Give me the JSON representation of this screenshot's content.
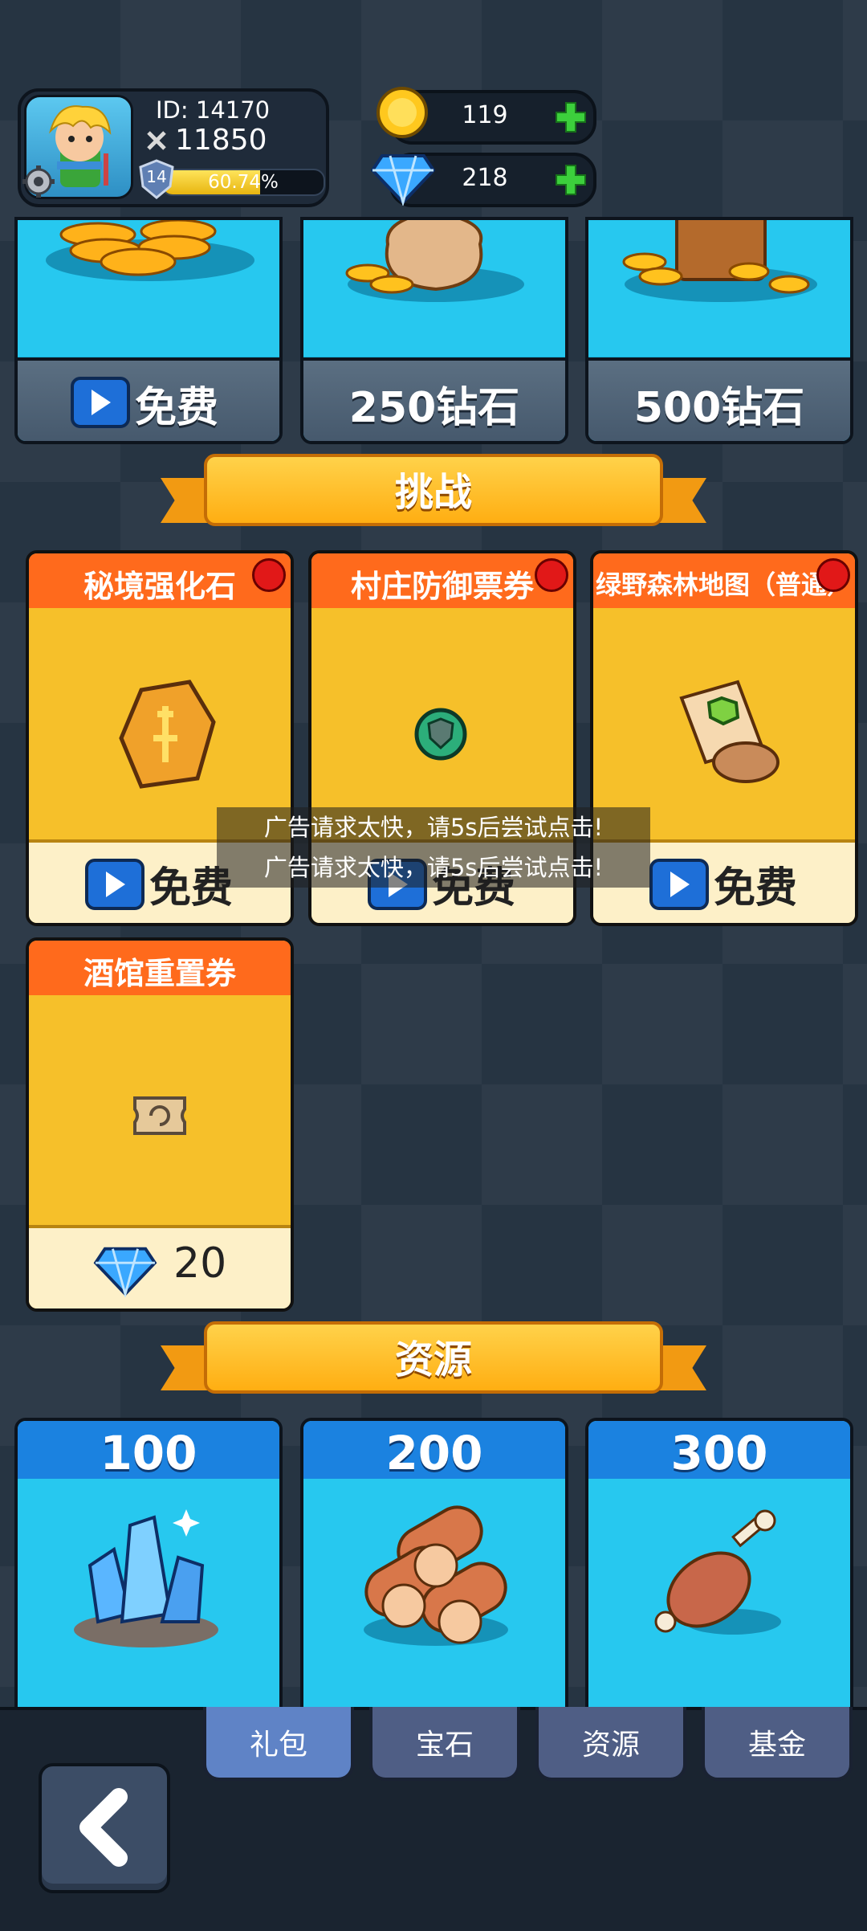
{
  "header": {
    "player_id": "ID: 14170",
    "power": "11850",
    "level": "14",
    "exp_percent_text": "60.74%",
    "exp_fraction": 0.6074,
    "gold": "119",
    "diamonds": "218"
  },
  "top_offers": [
    {
      "label": "免费",
      "has_video_icon": true
    },
    {
      "label": "250钻石"
    },
    {
      "label": "500钻石"
    }
  ],
  "sections": {
    "challenge_title": "挑战",
    "resource_title": "资源"
  },
  "challenge_items": [
    {
      "name": "秘境强化石",
      "price": "免费",
      "has_video_icon": true,
      "red_dot": true
    },
    {
      "name": "村庄防御票券",
      "price": "免费",
      "has_video_icon": true,
      "red_dot": true
    },
    {
      "name": "绿野森林地图（普通）",
      "price": "免费",
      "has_video_icon": true,
      "red_dot": true
    },
    {
      "name": "酒馆重置券",
      "price": "20",
      "price_icon": "diamond-icon"
    }
  ],
  "toasts": [
    "广告请求太快，请5s后尝试点击!",
    "广告请求太快，请5s后尝试点击!"
  ],
  "resources": [
    {
      "amount": "100",
      "icon": "crystal-icon"
    },
    {
      "amount": "200",
      "icon": "wood-icon"
    },
    {
      "amount": "300",
      "icon": "meat-icon"
    }
  ],
  "tabs": [
    {
      "label": "礼包",
      "active": true
    },
    {
      "label": "宝石",
      "active": false
    },
    {
      "label": "资源",
      "active": false
    },
    {
      "label": "基金",
      "active": false
    }
  ],
  "colors": {
    "background": "#263442",
    "ribbon": "#ffae12",
    "card_header": "#ff6a1c",
    "card_body": "#f6c02a",
    "resource_header": "#1b82e0",
    "resource_body": "#27c8ef",
    "tab_active": "#5f83c6"
  }
}
